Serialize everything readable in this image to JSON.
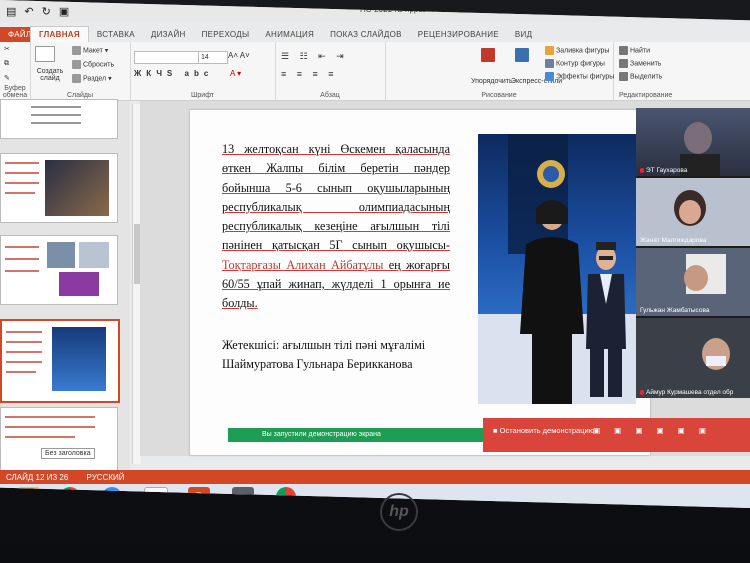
{
  "window": {
    "title": "ПС-2021 №4.pptx - PowerPoint"
  },
  "tabs": [
    "ФАЙЛ",
    "ГЛАВНАЯ",
    "ВСТАВКА",
    "ДИЗАЙН",
    "ПЕРЕХОДЫ",
    "АНИМАЦИЯ",
    "ПОКАЗ СЛАЙДОВ",
    "РЕЦЕНЗИРОВАНИЕ",
    "ВИД"
  ],
  "ribbon": {
    "clipboard": {
      "paste": "Вставить",
      "group": "Буфер обмена"
    },
    "slides": {
      "new_slide": "Создать слайд",
      "layout": "Макет",
      "reset": "Сбросить",
      "section": "Раздел",
      "group": "Слайды"
    },
    "font": {
      "font_name": "",
      "font_size": "14",
      "group": "Шрифт"
    },
    "paragraph": {
      "group": "Абзац"
    },
    "drawing": {
      "arrange": "Упорядочить",
      "quick_styles": "Экспресс-стили",
      "shape_fill": "Заливка фигуры",
      "shape_outline": "Контур фигуры",
      "shape_effects": "Эффекты фигуры",
      "group": "Рисование"
    },
    "editing": {
      "find": "Найти",
      "replace": "Заменить",
      "select": "Выделить",
      "group": "Редактирование"
    }
  },
  "slide": {
    "paragraph1_parts": [
      {
        "t": "13 желтоқсан күні Өскемен қаласында өткен Жалпы білім беретін пәндер бойынша 5-6 сынып оқушыларының республикалық олимпиадасының республикалық кезеңіне ағылшын тілі пәнінен қатысқан 5Г сынып оқушысы-",
        "cls": "u"
      },
      {
        "t": "Тоқтарғазы Алихан Айбатұлы",
        "cls": "u red"
      },
      {
        "t": " ең жоғарғы 60/55 ұпай жинап, жүлделі 1 орынға ие болды.",
        "cls": "u"
      }
    ],
    "paragraph2_parts": [
      {
        "t": "Жетекшісі: ағылшын тілі пәні мұғалімі ",
        "cls": "u"
      },
      {
        "t": "Шаймуратова Гульнара Берикканова",
        "cls": "u red"
      }
    ]
  },
  "thumbnail_label": "Без заголовка",
  "participants": [
    "ЭТ Гаухарова",
    "Жанат Малгиждарова",
    "Гульжан Жамбатысова",
    "Аймур Курмашева отдел обр"
  ],
  "share_bar": {
    "text": "Вы запустили демонстрацию экрана"
  },
  "stop_share": {
    "text": "Остановить демонстрацию"
  },
  "status": {
    "slide_counter": "СЛАЙД 12 ИЗ 26",
    "language": "РУССКИЙ"
  },
  "taskbar_icons": [
    "file-explorer-icon",
    "chrome-icon",
    "zoom-icon",
    "notes-icon",
    "powerpoint-icon",
    "camera-icon",
    "chrome-icon"
  ],
  "brand": "hp"
}
